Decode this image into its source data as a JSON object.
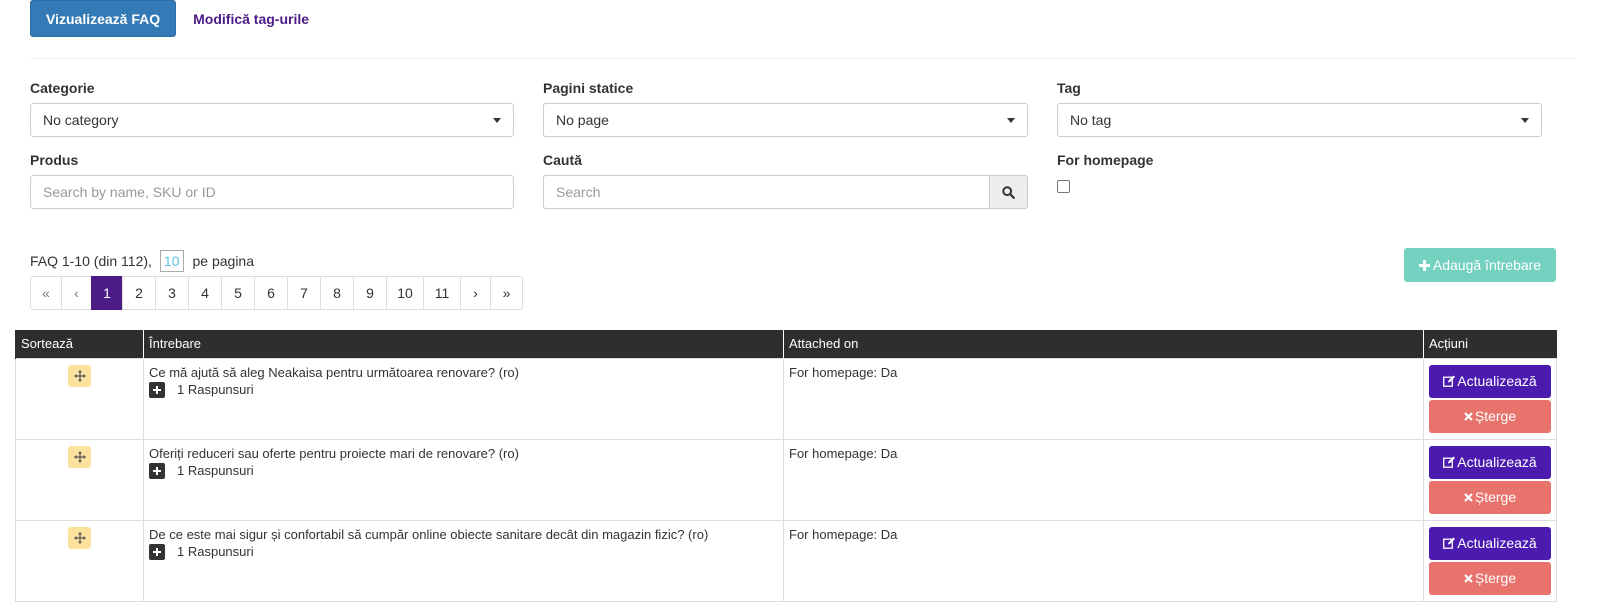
{
  "header": {
    "view_faq_label": "Vizualizează FAQ",
    "edit_tags_label": "Modifică tag-urile"
  },
  "filters": {
    "category": {
      "label": "Categorie",
      "value": "No category"
    },
    "static_pages": {
      "label": "Pagini statice",
      "value": "No page"
    },
    "tag": {
      "label": "Tag",
      "value": "No tag"
    },
    "product": {
      "label": "Produs",
      "placeholder": "Search by name, SKU or ID"
    },
    "search": {
      "label": "Caută",
      "placeholder": "Search"
    },
    "homepage": {
      "label": "For homepage",
      "checked": false
    }
  },
  "listing": {
    "count_text": "FAQ 1-10 (din 112),",
    "per_page_value": "10",
    "per_page_suffix": "pe pagina",
    "add_button_label": "Adaugă întrebare"
  },
  "pagination": {
    "first": "«",
    "prev": "‹",
    "pages": [
      "1",
      "2",
      "3",
      "4",
      "5",
      "6",
      "7",
      "8",
      "9",
      "10",
      "11"
    ],
    "active": "1",
    "next": "›",
    "last": "»"
  },
  "table": {
    "headers": [
      "Sortează",
      "Întrebare",
      "Attached on",
      "Acțiuni"
    ],
    "update_label": "Actualizează",
    "delete_label": "Șterge",
    "rows": [
      {
        "question": "Ce mă ajută să aleg Neakaisa pentru următoarea renovare? (ro)",
        "answers": "1 Raspunsuri",
        "attached": "For homepage: Da"
      },
      {
        "question": "Oferiți reduceri sau oferte pentru proiecte mari de renovare? (ro)",
        "answers": "1 Raspunsuri",
        "attached": "For homepage: Da"
      },
      {
        "question": "De ce este mai sigur și confortabil să cumpăr online obiecte sanitare decât din magazin fizic? (ro)",
        "answers": "1 Raspunsuri",
        "attached": "For homepage: Da"
      }
    ]
  },
  "colors": {
    "primary": "#337ab7",
    "brand_purple": "#4b1b86",
    "update_button": "#4b1bb0",
    "delete_button": "#e8736d",
    "add_button": "#74d1c0",
    "table_header": "#2e2e2e",
    "drag_handle": "#fbe39e"
  },
  "icons": {
    "search": "search-icon",
    "plus": "plus-icon",
    "move": "move-icon",
    "edit": "edit-icon",
    "delete": "times-icon",
    "caret": "caret-down-icon"
  }
}
